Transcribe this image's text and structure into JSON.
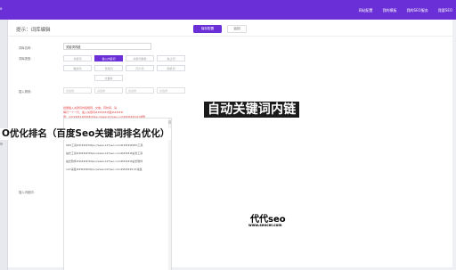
{
  "topbar": {
    "brand": "o",
    "nav": [
      "网站配置",
      "我的模板",
      "我的SEO服务",
      "我要SEO"
    ]
  },
  "page": {
    "title": "提示：词库编辑",
    "save_label": "保存配置",
    "back_label": "返回"
  },
  "form": {
    "name_label": "词库名称：",
    "name_value": "关键词内链",
    "type_label": "词库类型：",
    "type_options": [
      [
        "关键词",
        "插入内链词",
        "关键词替换",
        "禁止词"
      ],
      [
        "敏感词",
        "长尾词",
        "同义词",
        "随机词"
      ],
      [
        "文章库"
      ]
    ],
    "insert_label": "插入规则：",
    "insert_rules": [
      "请选择",
      "请选择",
      "请选择",
      "请选择"
    ],
    "hint_lines": [
      "批量插入关键词内链规则，文章，同时间，请",
      "每行一个一行，插入关键词#####内链#####",
      "例：1472##1####https://www.147seo.com#####147减量"
    ],
    "content_label": "插入内链词：",
    "content_lines": [
      "SEO工具#####https://www.147seo.com#####SEO工具",
      "站长工具#####https://www.147seo.com#####站长工具",
      "站长软件#####https://www.147seo.com#####站长软件",
      "147采集#####https://www.147seo.com#####147采集"
    ],
    "content_link_text": "https://www.147seo.com"
  },
  "overlay": {
    "big_caption": "自动关键词内链",
    "bottom_caption": "O优化排名（百度Seo关键词排名优化）"
  },
  "watermark": {
    "title": "代代seo",
    "url": "www.seocer.com"
  }
}
